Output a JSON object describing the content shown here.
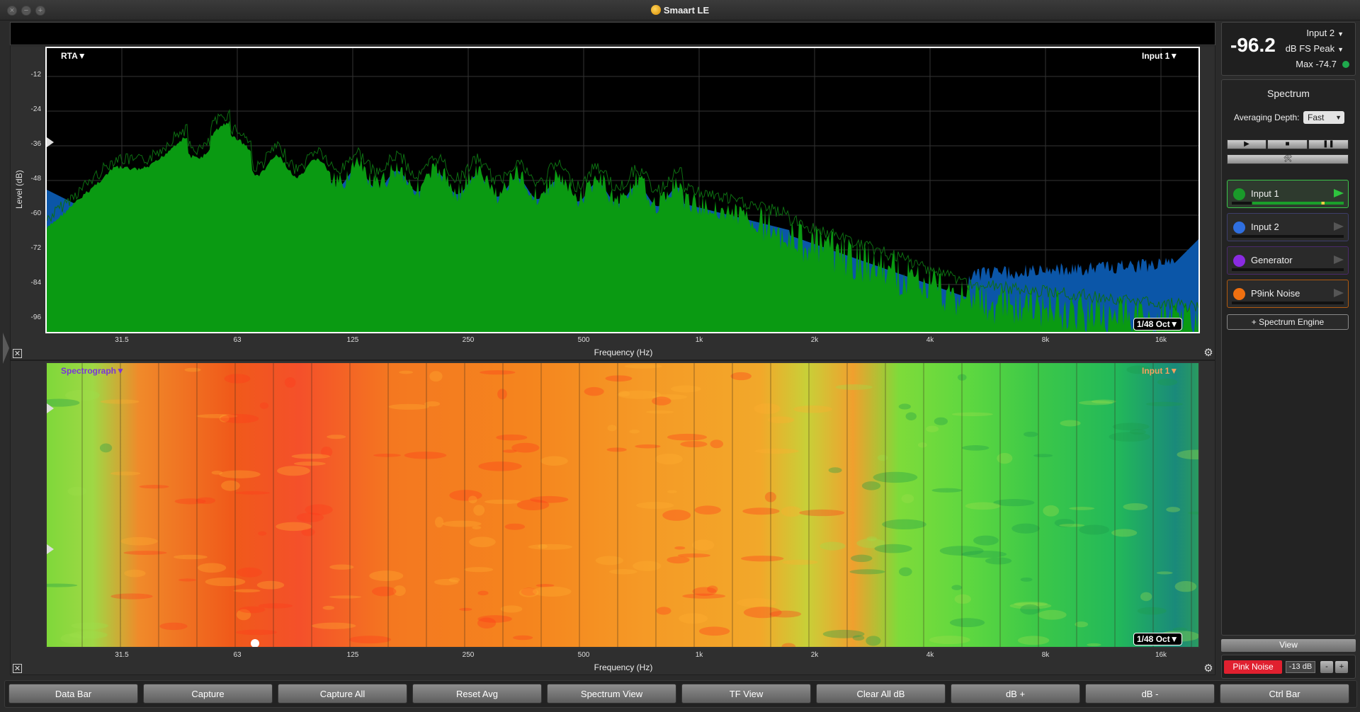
{
  "window": {
    "title": "Smaart LE",
    "buttons": {
      "close": "×",
      "minimize": "−",
      "zoom": "+"
    }
  },
  "rta": {
    "mode_label": "RTA▼",
    "input_label": "Input 1▼",
    "resolution": "1/48 Oct▼",
    "ylabel": "Level (dB)",
    "xlabel": "Frequency (Hz)",
    "y_ticks": [
      "-12",
      "-24",
      "-36",
      "-48",
      "-60",
      "-72",
      "-84",
      "-96"
    ],
    "x_ticks": [
      "31.5",
      "63",
      "125",
      "250",
      "500",
      "1k",
      "2k",
      "4k",
      "8k",
      "16k"
    ]
  },
  "spectrograph": {
    "mode_label": "Spectrograph▼",
    "input_label": "Input 1▼",
    "resolution": "1/48 Oct▼",
    "xlabel": "Frequency (Hz)",
    "x_ticks": [
      "31.5",
      "63",
      "125",
      "250",
      "500",
      "1k",
      "2k",
      "4k",
      "8k",
      "16k"
    ]
  },
  "meter": {
    "value": "-96.2",
    "input": "Input 2",
    "unit": "dB FS Peak",
    "max": "Max -74.7"
  },
  "spectrum_panel": {
    "title": "Spectrum",
    "averaging_label": "Averaging Depth:",
    "averaging_value": "Fast",
    "transport": {
      "play": "▶",
      "stop": "■",
      "pause": "❚❚",
      "tools": "🛠"
    },
    "sources": [
      {
        "name": "Input 1",
        "color": "#1a9a2a",
        "border": "#3cc44a"
      },
      {
        "name": "Input 2",
        "color": "#2f6fe0",
        "border": "#3d3d6a"
      },
      {
        "name": "Generator",
        "color": "#8a2be2",
        "border": "#4a2a6a"
      },
      {
        "name": "P9ink Noise",
        "color": "#f07010",
        "border": "#b05a10"
      }
    ],
    "add_engine": "+ Spectrum Engine"
  },
  "side_controls": {
    "view": "View",
    "pink_noise": "Pink Noise",
    "gen_level": "-13 dB",
    "minus": "-",
    "plus": "+"
  },
  "command_bar": [
    "Data Bar",
    "Capture",
    "Capture All",
    "Reset Avg",
    "Spectrum View",
    "TF View",
    "Clear All dB",
    "dB +",
    "dB -",
    "Ctrl Bar"
  ],
  "colors": {
    "rta_live": "#0a9a12",
    "rta_avg": "#0b56a8",
    "accent_red": "#e0202f"
  }
}
